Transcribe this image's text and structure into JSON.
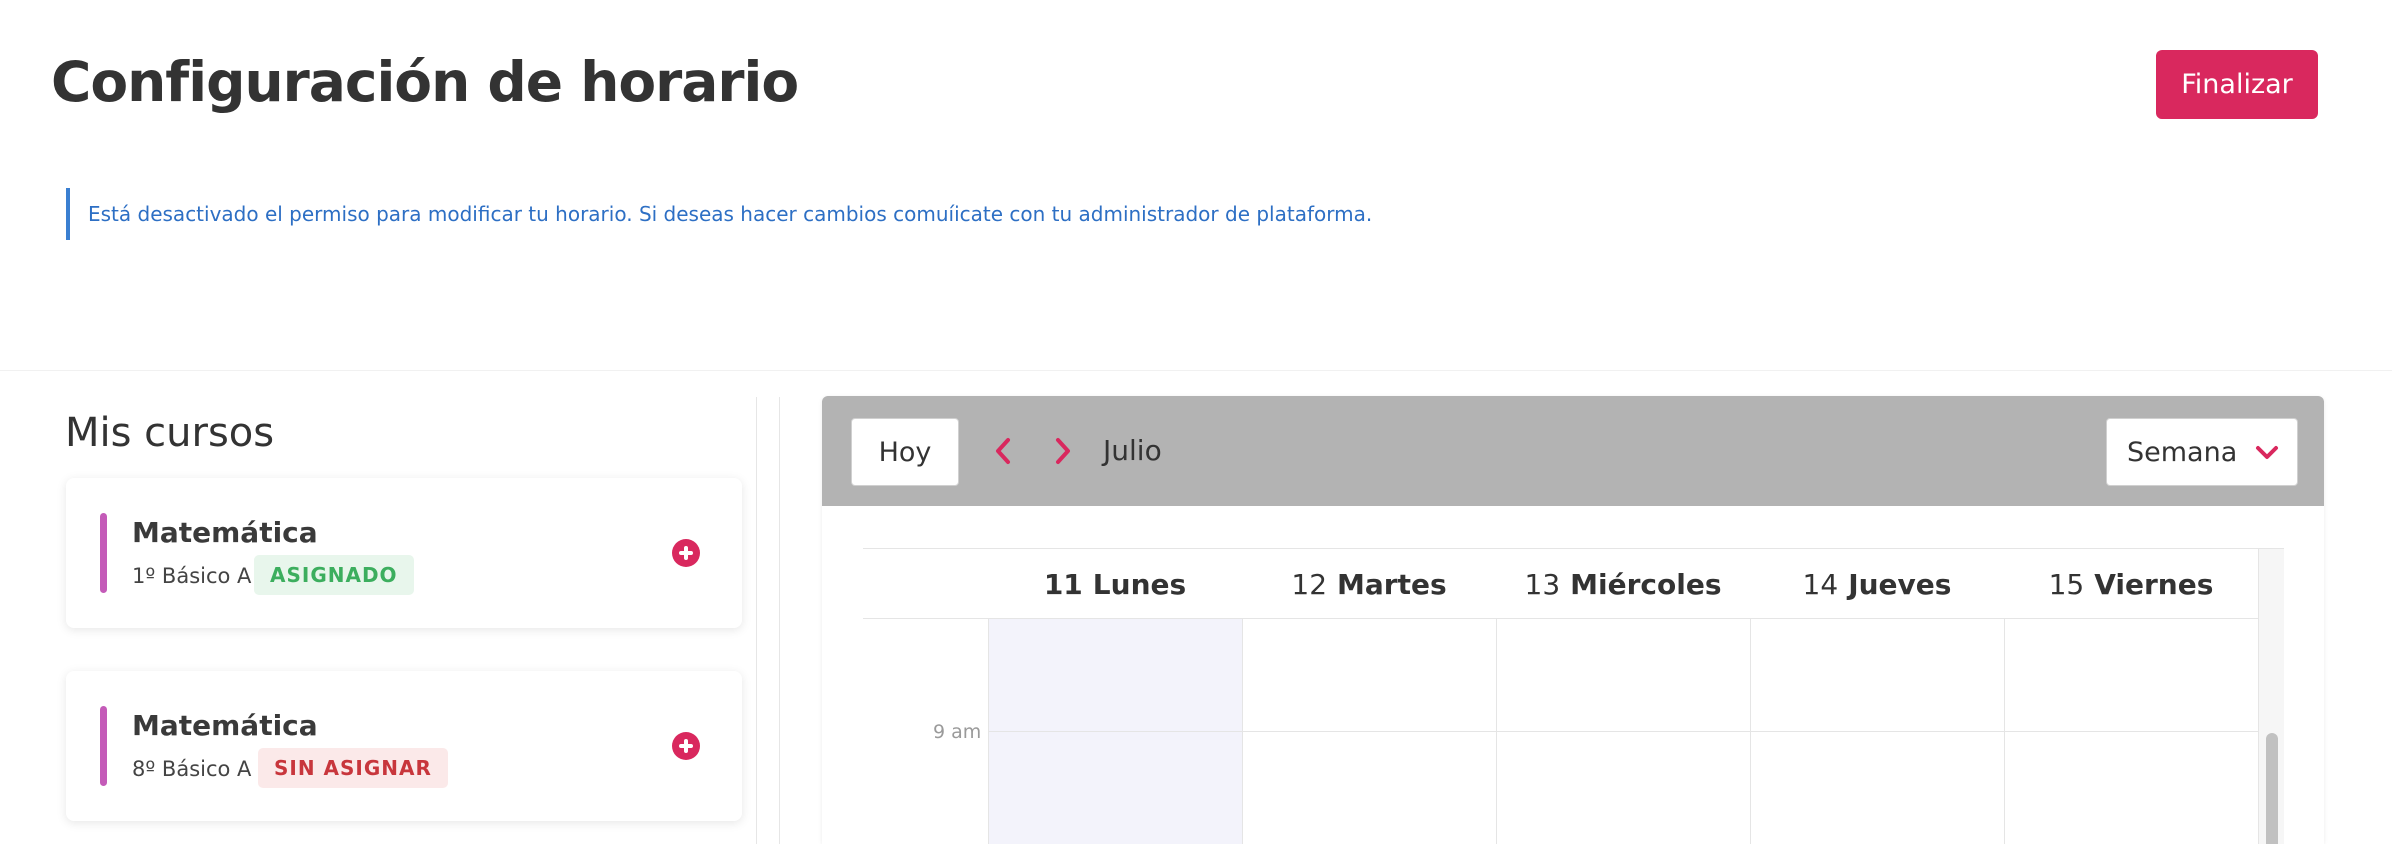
{
  "header": {
    "title": "Configuración de horario",
    "finish_label": "Finalizar"
  },
  "notice": {
    "text": "Está desactivado el permiso para modificar tu horario. Si deseas hacer cambios comuíicate con tu administrador de plataforma."
  },
  "courses": {
    "title": "Mis cursos",
    "items": [
      {
        "name": "Matemática",
        "group": "1º Básico A",
        "status": "ASIGNADO"
      },
      {
        "name": "Matemática",
        "group": "8º Básico A",
        "status": "SIN ASIGNAR"
      }
    ]
  },
  "calendar": {
    "today_label": "Hoy",
    "month": "Julio",
    "view": "Semana",
    "days": [
      {
        "num": "11",
        "name": "Lunes"
      },
      {
        "num": "12",
        "name": "Martes"
      },
      {
        "num": "13",
        "name": "Miércoles"
      },
      {
        "num": "14",
        "name": "Jueves"
      },
      {
        "num": "15",
        "name": "Viernes"
      }
    ],
    "time_labels": [
      "9 am"
    ]
  },
  "colors": {
    "accent": "#d9285e",
    "notice": "#2d6fc4",
    "course_bar": "#c45bb8",
    "assigned": "#3cae5e",
    "unassigned": "#c8363c",
    "toolbar": "#b3b3b3"
  },
  "icons": {
    "prev": "chevron-left-icon",
    "next": "chevron-right-icon",
    "view_dropdown": "chevron-down-icon",
    "add": "plus-circle-icon"
  }
}
